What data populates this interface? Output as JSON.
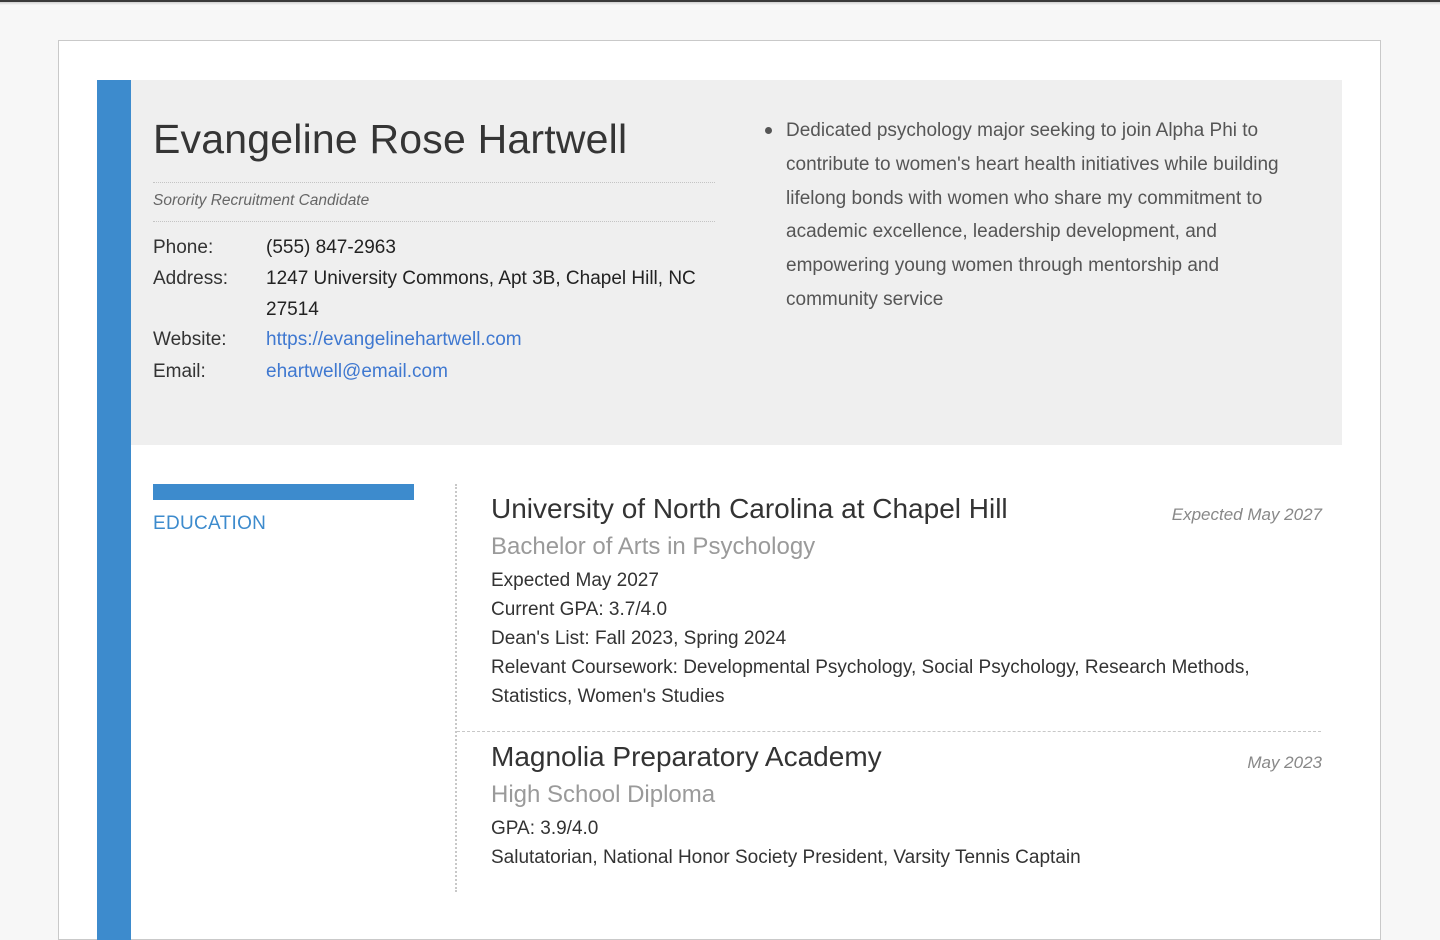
{
  "header": {
    "name": "Evangeline Rose Hartwell",
    "subtitle": "Sorority Recruitment Candidate",
    "contact": {
      "phone_label": "Phone:",
      "phone": "(555) 847-2963",
      "address_label": "Address:",
      "address_line1": "1247 University Commons, Apt 3B, Chapel Hill, NC",
      "address_line2": "27514",
      "website_label": "Website:",
      "website": "https://evangelinehartwell.com",
      "email_label": "Email:",
      "email": "ehartwell@email.com"
    },
    "objective_lines": [
      "Dedicated psychology major seeking to join Alpha Phi to",
      "contribute to women's heart health initiatives while building",
      "lifelong bonds with women who share my commitment to",
      "academic excellence, leadership development, and",
      "empowering young women through mentorship and",
      "community service"
    ]
  },
  "education": {
    "section_title": "EDUCATION",
    "entries": [
      {
        "institution": "University of North Carolina at Chapel Hill",
        "degree": "Bachelor of Arts in Psychology",
        "date": "Expected May 2027",
        "details": [
          "Expected May 2027",
          "Current GPA: 3.7/4.0",
          "Dean's List: Fall 2023, Spring 2024",
          "Relevant Coursework: Developmental Psychology, Social Psychology, Research Methods,",
          "Statistics, Women's Studies"
        ]
      },
      {
        "institution": "Magnolia Preparatory Academy",
        "degree": "High School Diploma",
        "date": "May 2023",
        "details": [
          "GPA: 3.9/4.0",
          "Salutatorian, National Honor Society President, Varsity Tennis Captain"
        ]
      }
    ]
  },
  "colors": {
    "accent": "#3d8bcd",
    "link": "#3f78d0",
    "header_bg": "#efefef"
  }
}
